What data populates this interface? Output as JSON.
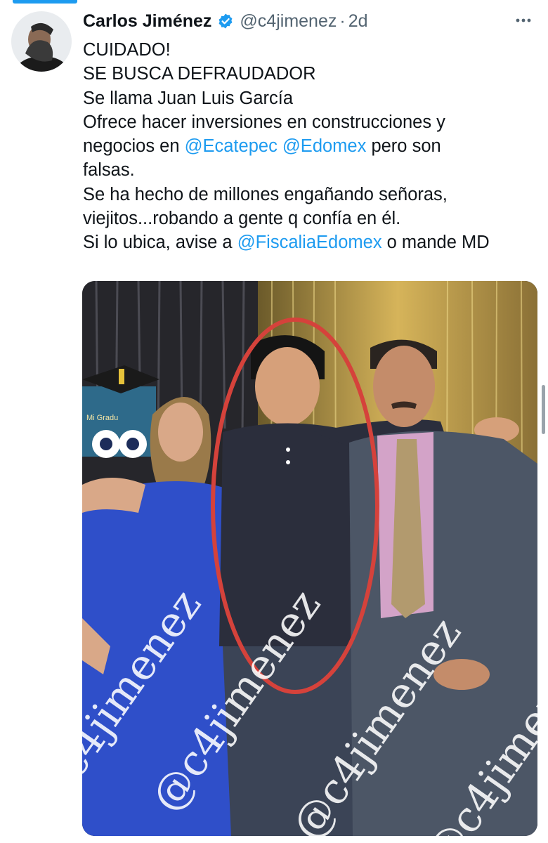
{
  "tweet": {
    "author": {
      "name": "Carlos Jiménez",
      "handle": "@c4jimenez",
      "separator": "·",
      "time": "2d",
      "verified": true
    },
    "text": {
      "line1": "CUIDADO!",
      "line2": "SE BUSCA DEFRAUDADOR",
      "line3": "Se llama Juan Luis García",
      "line4": "Ofrece hacer inversiones en construcciones y",
      "line5_pre": "negocios en ",
      "mention_ecatepec": "@Ecatepec",
      "mention_edomex": "@Edomex",
      "line5_post": " pero son",
      "line6": "falsas.",
      "line7": "Se ha hecho de millones engañando señoras,",
      "line8": "viejitos...robando a gente q confía en él.",
      "line9_pre": "Si lo ubica, avise a ",
      "mention_fiscalia": "@FiscaliaEdomex",
      "line9_post": " o mande MD"
    },
    "media": {
      "watermark": "@c4jimenez",
      "banner_text": "Mi Gradu"
    }
  },
  "icons": {
    "verified": "verified-badge-icon",
    "more": "more-options-icon"
  },
  "colors": {
    "accent": "#1d9bf0",
    "text": "#0f1419",
    "muted": "#536471"
  }
}
